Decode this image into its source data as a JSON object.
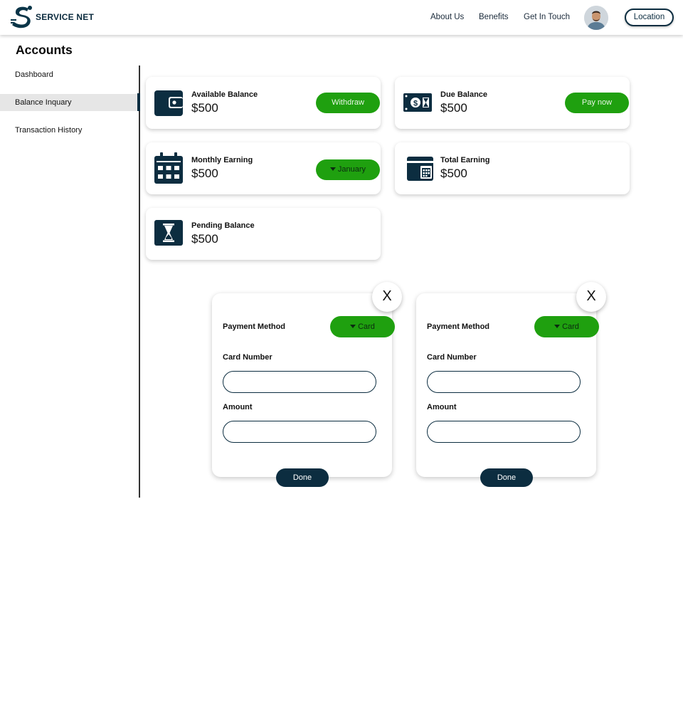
{
  "header": {
    "brand": "SERVICE NET",
    "nav": [
      "About Us",
      "Benefits",
      "Get In Touch"
    ],
    "location_label": "Location"
  },
  "page_title": "Accounts",
  "sidebar": {
    "items": [
      {
        "label": "Dashboard",
        "active": false
      },
      {
        "label": "Balance Inquary",
        "active": true
      },
      {
        "label": "Transaction History",
        "active": false
      }
    ]
  },
  "cards": [
    {
      "label": "Available Balance",
      "value": "$500",
      "icon": "wallet-icon",
      "action": "Withdraw"
    },
    {
      "label": "Due Balance",
      "value": "$500",
      "icon": "money-bill-icon",
      "action": "Pay now"
    },
    {
      "label": "Monthly Earning",
      "value": "$500",
      "icon": "calendar-icon",
      "select": "January"
    },
    {
      "label": "Total Earning",
      "value": "$500",
      "icon": "card-calendar-icon"
    },
    {
      "label": "Pending Balance",
      "value": "$500",
      "icon": "hourglass-icon"
    }
  ],
  "payment_panels": [
    {
      "close_label": "X",
      "method_label": "Payment Method",
      "method_value": "Card",
      "card_number_label": "Card Number",
      "card_number_value": "",
      "amount_label": "Amount",
      "amount_value": "",
      "done_label": "Done"
    },
    {
      "close_label": "X",
      "method_label": "Payment Method",
      "method_value": "Card",
      "card_number_label": "Card Number",
      "card_number_value": "",
      "amount_label": "Amount",
      "amount_value": "",
      "done_label": "Done"
    }
  ],
  "colors": {
    "navy": "#0c2d40",
    "green": "#1fa00f",
    "sidebar_active": "#e6e6e6"
  }
}
